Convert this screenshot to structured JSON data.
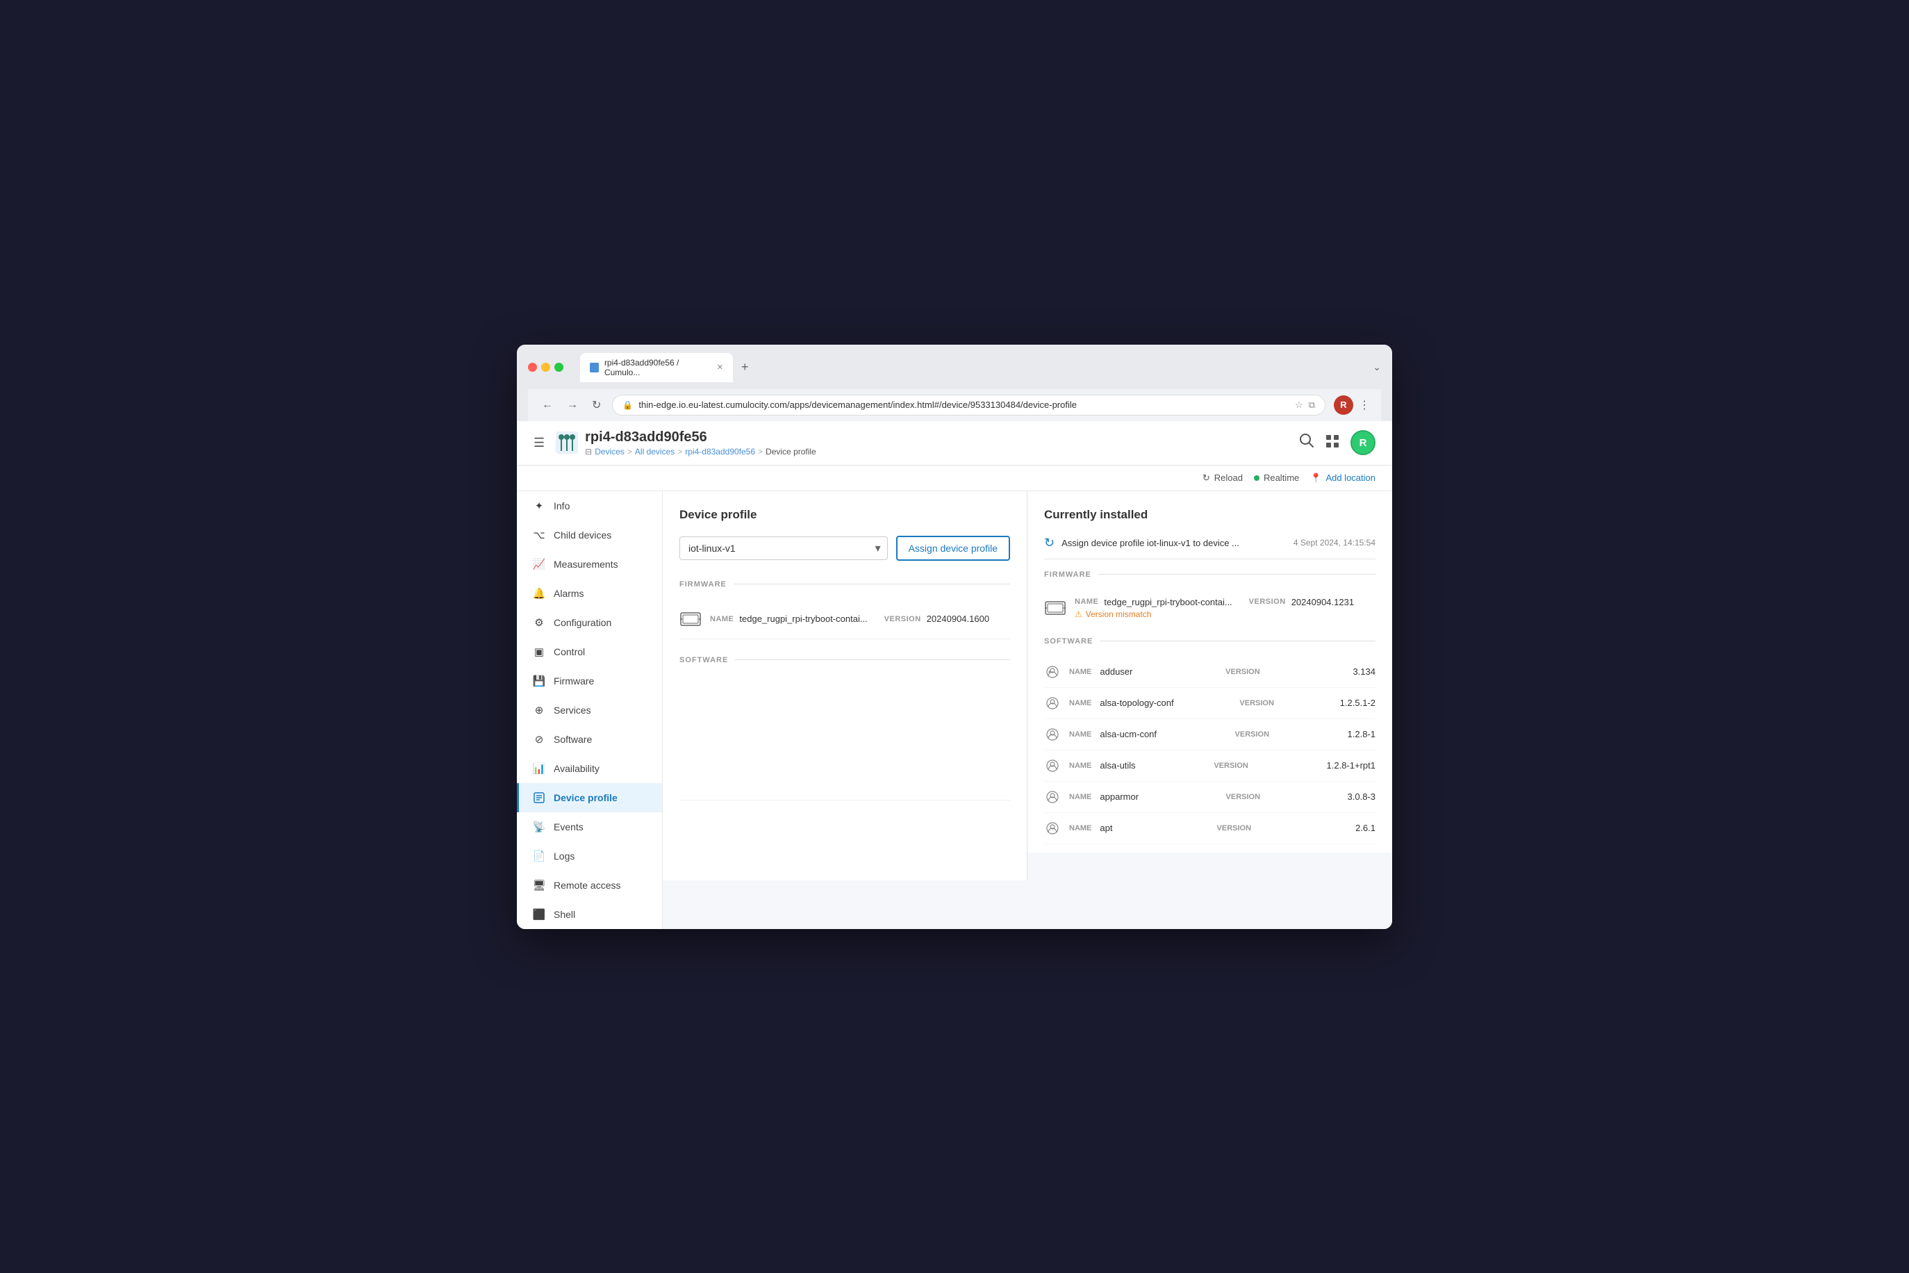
{
  "browser": {
    "tab_title": "rpi4-d83add90fe56 / Cumulo...",
    "url": "thin-edge.io.eu-latest.cumulocity.com/apps/devicemanagement/index.html#/device/9533130484/device-profile",
    "close_icon": "✕",
    "add_tab_icon": "+",
    "expand_icon": "⌄",
    "back_icon": "←",
    "forward_icon": "→",
    "refresh_icon": "↻",
    "shield_icon": "🔒",
    "star_icon": "☆",
    "extension_icon": "⧉",
    "menu_icon": "⋮",
    "avatar_label": "R",
    "avatar_bg": "#c0392b"
  },
  "app": {
    "hamburger_icon": "☰",
    "title": "rpi4-d83add90fe56",
    "breadcrumb": {
      "devices": "Devices",
      "all_devices": "All devices",
      "device": "rpi4-d83add90fe56",
      "current": "Device profile"
    },
    "search_icon": "🔍",
    "grid_icon": "⊞",
    "user_avatar": "R",
    "user_avatar_bg": "#27ae60"
  },
  "topbar": {
    "reload_label": "Reload",
    "reload_icon": "↻",
    "realtime_label": "Realtime",
    "add_location_label": "Add location",
    "add_location_icon": "📍"
  },
  "sidebar": {
    "items": [
      {
        "id": "info",
        "label": "Info",
        "icon": "✦"
      },
      {
        "id": "child-devices",
        "label": "Child devices",
        "icon": "⌥"
      },
      {
        "id": "measurements",
        "label": "Measurements",
        "icon": "📈"
      },
      {
        "id": "alarms",
        "label": "Alarms",
        "icon": "🔔"
      },
      {
        "id": "configuration",
        "label": "Configuration",
        "icon": "⚙"
      },
      {
        "id": "control",
        "label": "Control",
        "icon": "▣"
      },
      {
        "id": "firmware",
        "label": "Firmware",
        "icon": "💾"
      },
      {
        "id": "services",
        "label": "Services",
        "icon": "⊕"
      },
      {
        "id": "software",
        "label": "Software",
        "icon": "⊘"
      },
      {
        "id": "availability",
        "label": "Availability",
        "icon": "📊"
      },
      {
        "id": "device-profile",
        "label": "Device profile",
        "icon": "📋"
      },
      {
        "id": "events",
        "label": "Events",
        "icon": "📡"
      },
      {
        "id": "logs",
        "label": "Logs",
        "icon": "📄"
      },
      {
        "id": "remote-access",
        "label": "Remote access",
        "icon": "🖥"
      },
      {
        "id": "shell",
        "label": "Shell",
        "icon": "⬛"
      }
    ]
  },
  "left_panel": {
    "title": "Device profile",
    "selected_profile": "iot-linux-v1",
    "assign_button": "Assign device profile",
    "firmware_label": "FIRMWARE",
    "firmware": {
      "name_label": "NAME",
      "name_value": "tedge_rugpi_rpi-tryboot-contai...",
      "version_label": "VERSION",
      "version_value": "20240904.1600"
    },
    "software_label": "SOFTWARE"
  },
  "right_panel": {
    "title": "Currently installed",
    "installed_description": "Assign device profile iot-linux-v1 to device ...",
    "installed_date": "4 Sept 2024,",
    "installed_time": "14:15:54",
    "firmware_label": "FIRMWARE",
    "firmware": {
      "name_label": "NAME",
      "name_value": "tedge_rugpi_rpi-tryboot-contai...",
      "version_label": "VERSION",
      "version_value": "20240904.1231",
      "mismatch_label": "Version mismatch"
    },
    "software_label": "SOFTWARE",
    "software_items": [
      {
        "name_label": "NAME",
        "name": "adduser",
        "version_label": "VERSION",
        "version": "3.134"
      },
      {
        "name_label": "NAME",
        "name": "alsa-topology-conf",
        "version_label": "VERSION",
        "version": "1.2.5.1-2"
      },
      {
        "name_label": "NAME",
        "name": "alsa-ucm-conf",
        "version_label": "VERSION",
        "version": "1.2.8-1"
      },
      {
        "name_label": "NAME",
        "name": "alsa-utils",
        "version_label": "VERSION",
        "version": "1.2.8-1+rpt1"
      },
      {
        "name_label": "NAME",
        "name": "apparmor",
        "version_label": "VERSION",
        "version": "3.0.8-3"
      },
      {
        "name_label": "NAME",
        "name": "apt",
        "version_label": "VERSION",
        "version": "2.6.1"
      }
    ]
  },
  "colors": {
    "primary": "#1a7abf",
    "accent_green": "#27ae60",
    "warning": "#f39c12",
    "mismatch": "#e67e22",
    "sidebar_active_bg": "#e8f4fd",
    "sidebar_active_border": "#1a7abf"
  }
}
